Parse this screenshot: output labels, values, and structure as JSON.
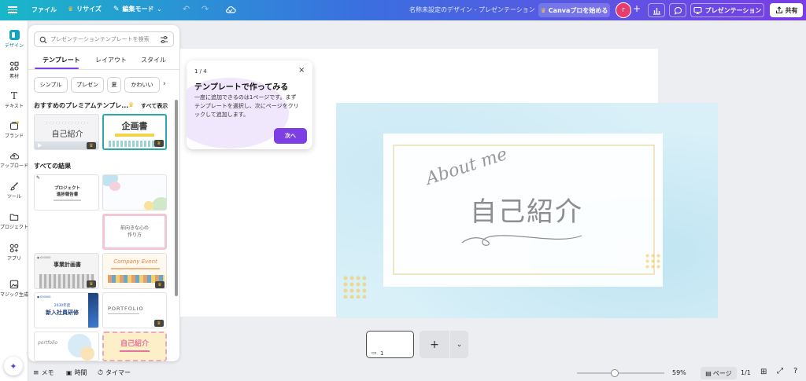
{
  "topbar": {
    "file": "ファイル",
    "resize": "リサイズ",
    "edit_mode": "編集モード",
    "doc_title": "名称未設定のデザイン - プレゼンテーション",
    "canva_pro": "Canvaプロを始める",
    "avatar_letter": "r",
    "present": "プレゼンテーション",
    "share": "共有"
  },
  "rail": [
    {
      "label": "デザイン"
    },
    {
      "label": "素材"
    },
    {
      "label": "テキスト"
    },
    {
      "label": "ブランド"
    },
    {
      "label": "アップロード"
    },
    {
      "label": "ツール"
    },
    {
      "label": "プロジェクト"
    },
    {
      "label": "アプリ"
    },
    {
      "label": "マジック生成"
    }
  ],
  "panel": {
    "search_placeholder": "プレゼンテーションテンプレートを検索",
    "tabs": [
      "テンプレート",
      "レイアウト",
      "スタイル"
    ],
    "chips": [
      "シンプル",
      "プレゼン",
      "夏",
      "かわいい"
    ],
    "premium_title": "おすすめのプレミアムテンプレ...",
    "see_all": "すべて表示",
    "all_results": "すべての結果",
    "thumbs": {
      "t1": "自己紹介",
      "t2": "企画書",
      "t3_l1": "プロジェクト",
      "t3_l2": "進捗報告書",
      "t5_l1": "前向きな心の",
      "t5_l2": "作り方",
      "t6": "事業計画書",
      "t7": "Company Event",
      "t8_l1": "2030年度",
      "t8_l2": "新入社員研修",
      "t9": "PORTFOLIO",
      "t10": "portfolio",
      "t11": "自己紹介"
    }
  },
  "tooltip": {
    "step": "1 / 4",
    "title": "テンプレートで作ってみる",
    "body_l1": "一度に追加できるのは1ページです。まず",
    "body_l2": "テンプレートを選択し、次にページをクリ",
    "body_l3": "ックして追加します。",
    "next": "次へ"
  },
  "slide": {
    "script": "About me",
    "title": "自己紹介"
  },
  "pages": {
    "page_number": "1"
  },
  "bottombar": {
    "notes": "メモ",
    "timer_clock": "時間",
    "timer": "タイマー",
    "zoom": "59%",
    "pages_label": "ページ",
    "page_count": "1/1",
    "zoom_value": 0.59
  },
  "colors": {
    "accent": "#7b3fe4",
    "topbar_start": "#19b7c9",
    "topbar_end": "#7a3de6"
  }
}
